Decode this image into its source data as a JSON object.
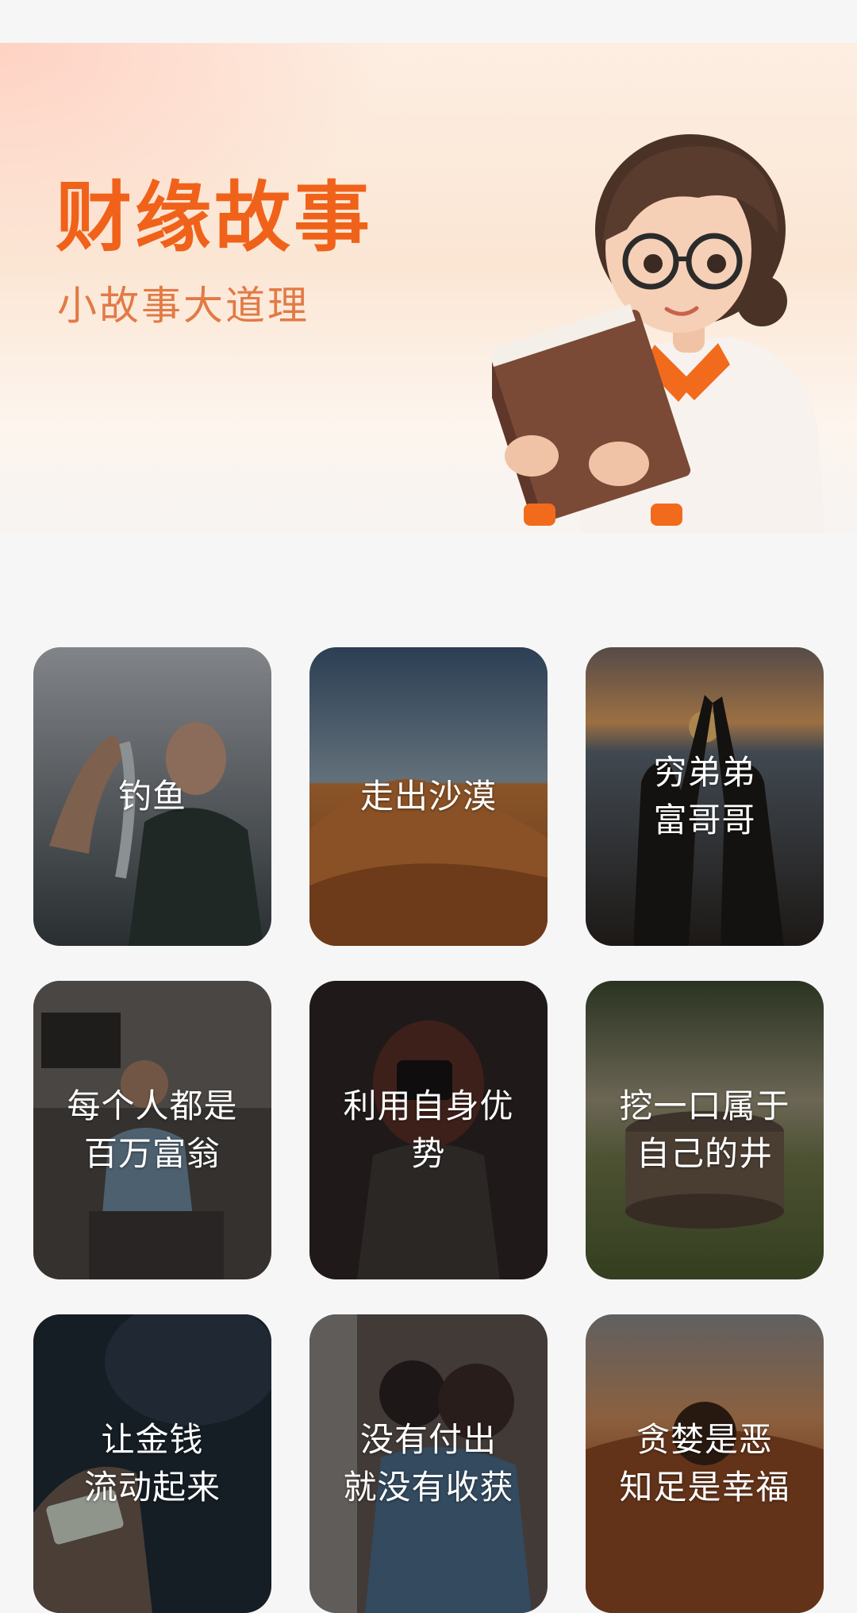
{
  "banner": {
    "title": "财缘故事",
    "subtitle": "小故事大道理"
  },
  "stories": [
    {
      "title": "钓鱼"
    },
    {
      "title": "走出沙漠"
    },
    {
      "title": "穷弟弟\n富哥哥"
    },
    {
      "title": "每个人都是\n百万富翁"
    },
    {
      "title": "利用自身优\n势"
    },
    {
      "title": "挖一口属于\n自己的井"
    },
    {
      "title": "让金钱\n流动起来"
    },
    {
      "title": "没有付出\n就没有收获"
    },
    {
      "title": "贪婪是恶\n知足是幸福"
    }
  ],
  "colors": {
    "accent": "#f0621a",
    "page_background": "#f6f6f7"
  }
}
